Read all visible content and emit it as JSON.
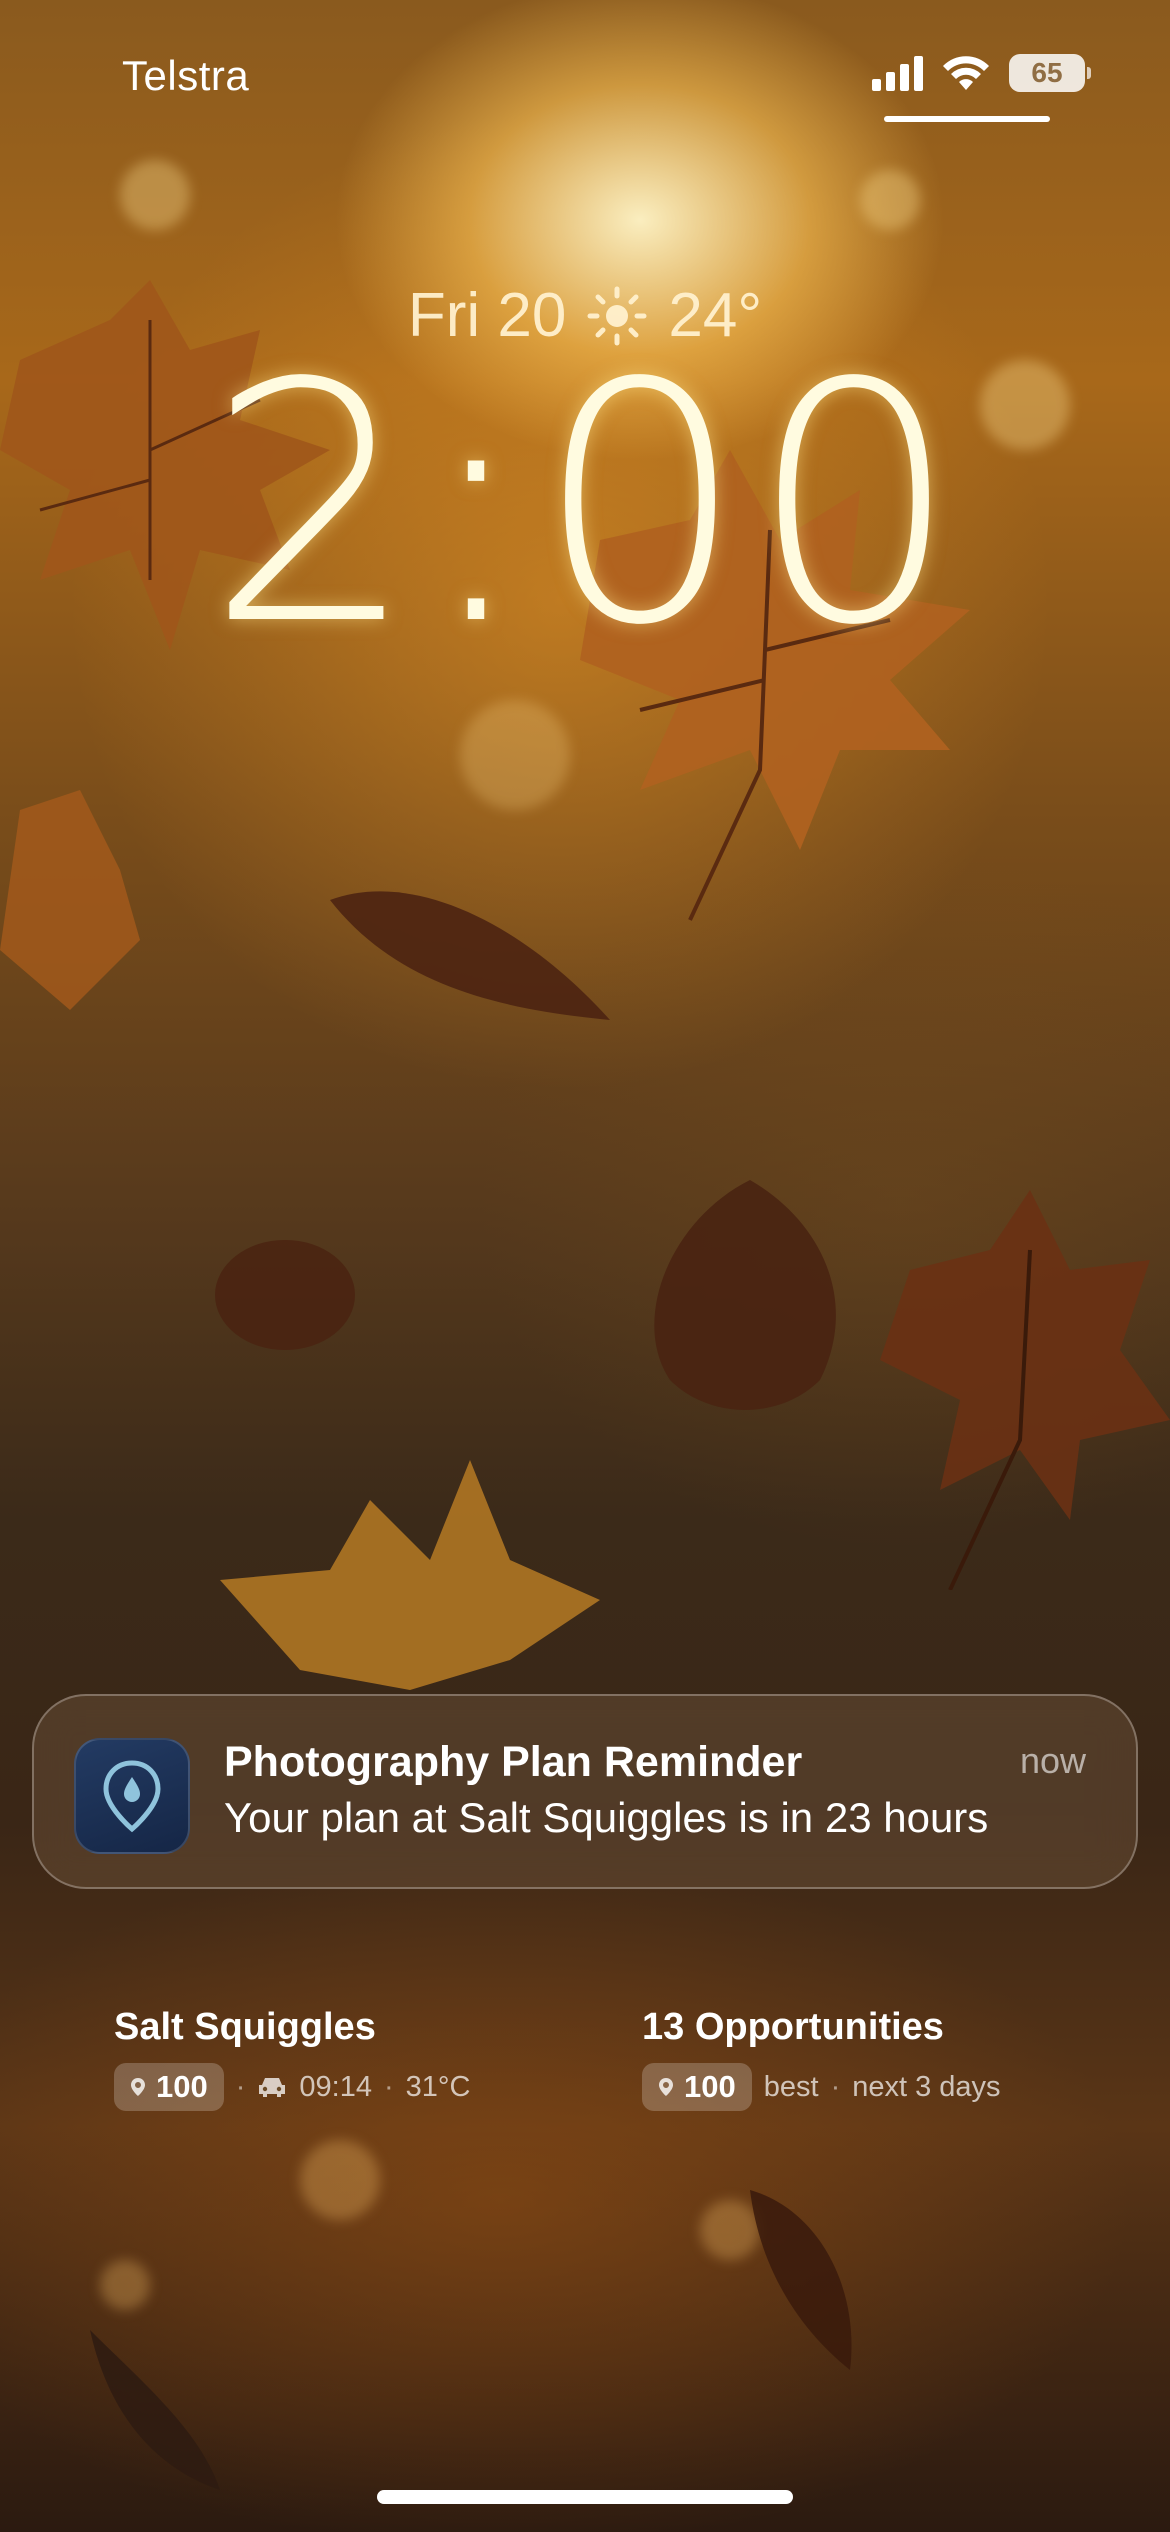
{
  "status_bar": {
    "carrier": "Telstra",
    "battery_percent": "65",
    "signal_icon": "cellular-signal-icon",
    "wifi_icon": "wifi-icon",
    "battery_icon": "battery-icon"
  },
  "lock_screen": {
    "date": "Fri 20",
    "weather_icon": "sun-icon",
    "temperature": "24°",
    "time": "2:00"
  },
  "notification": {
    "app_icon": "location-pin-icon",
    "title": "Photography Plan Reminder",
    "time": "now",
    "body": "Your plan at Salt Squiggles is in 23 hours"
  },
  "widgets": [
    {
      "title": "Salt Squiggles",
      "score": "100",
      "drive_time": "09:14",
      "temperature": "31°C"
    },
    {
      "title": "13 Opportunities",
      "score": "100",
      "label": "best",
      "range": "next 3 days"
    }
  ],
  "colors": {
    "clock": "#fffbe0",
    "notification_icon_bg": "#1c3052",
    "wallpaper_tone": "#8a5a1e"
  }
}
